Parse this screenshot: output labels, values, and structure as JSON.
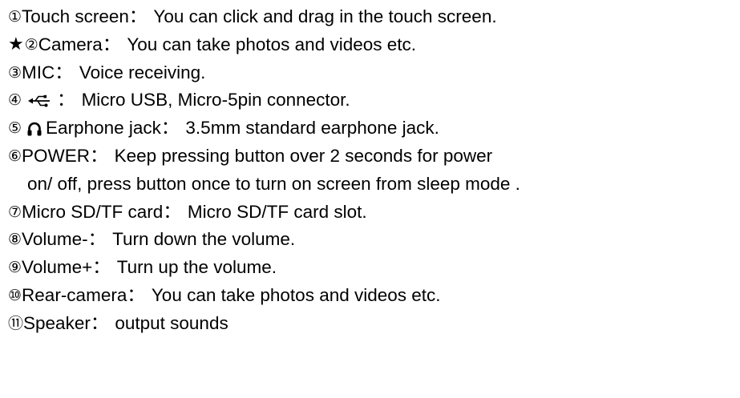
{
  "lines": [
    {
      "num": "①",
      "term": "Touch screen",
      "sep": "：",
      "desc": "You can click and drag in the touch screen."
    },
    {
      "star": "★",
      "num": "②",
      "term": "Camera",
      "sep": "：",
      "desc": "You can take photos and videos etc."
    },
    {
      "num": "③",
      "term": "MIC",
      "sep": "：",
      "desc": "Voice receiving."
    },
    {
      "num": "④",
      "icon": "usb-icon",
      "sep": "：",
      "desc": "Micro USB, Micro-5pin connector."
    },
    {
      "num": "⑤",
      "icon": "headphone-icon",
      "term": "Earphone jack",
      "sep": "：",
      "desc": "3.5mm standard earphone jack."
    },
    {
      "num": "⑥",
      "term": "POWER",
      "sep": "：",
      "desc": "Keep pressing button over 2 seconds for power",
      "desc_cont": "on/ off, press button once to turn on screen from sleep mode ."
    },
    {
      "num": "⑦",
      "term": "Micro SD/TF card",
      "sep": "：",
      "desc": "Micro SD/TF card slot."
    },
    {
      "num": "⑧",
      "term": "Volume-",
      "sep": "：",
      "desc": "Turn down the volume."
    },
    {
      "num": "⑨",
      "term": "Volume+",
      "sep": "：",
      "desc": "Turn up the volume."
    },
    {
      "num": "⑩",
      "term": "Rear-camera",
      "sep": "：",
      "desc": "You can take photos and videos etc."
    },
    {
      "num": "⑪",
      "term": "Speaker",
      "sep": "：",
      "desc": "output sounds"
    }
  ],
  "colors": {
    "text": "#000000",
    "background": "#ffffff"
  }
}
